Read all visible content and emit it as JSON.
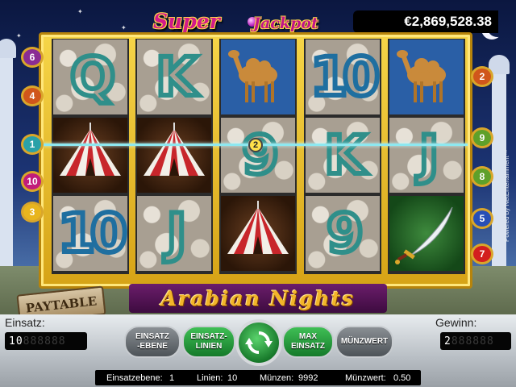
{
  "jackpot": {
    "super_label": "Super",
    "jackpot_label": "Jackpot",
    "amount": "€2,869,528.38"
  },
  "reels": [
    [
      {
        "symbol": "Q",
        "type": "letter-blue"
      },
      {
        "symbol": "tent",
        "type": "tent"
      },
      {
        "symbol": "10",
        "type": "number-blue"
      }
    ],
    [
      {
        "symbol": "K",
        "type": "letter-green"
      },
      {
        "symbol": "tent",
        "type": "tent"
      },
      {
        "symbol": "J",
        "type": "letter-teal"
      }
    ],
    [
      {
        "symbol": "camel",
        "type": "camel"
      },
      {
        "symbol": "9",
        "type": "number-green"
      },
      {
        "symbol": "tent",
        "type": "tent"
      }
    ],
    [
      {
        "symbol": "10",
        "type": "number-blue"
      },
      {
        "symbol": "K",
        "type": "letter-green"
      },
      {
        "symbol": "9",
        "type": "number-green"
      }
    ],
    [
      {
        "symbol": "camel",
        "type": "camel"
      },
      {
        "symbol": "J",
        "type": "letter-teal"
      },
      {
        "symbol": "sword",
        "type": "sword"
      }
    ]
  ],
  "line_markers": {
    "left": [
      "6",
      "4",
      "1",
      "10",
      "3"
    ],
    "right": [
      "2",
      "9",
      "8",
      "5",
      "7"
    ]
  },
  "active_payline_badge": "2",
  "title_banner": "Arabian Nights",
  "paytable_label": "PAYTABLE",
  "panel": {
    "bet_label": "Einsatz:",
    "bet_value": "10",
    "bet_ghost": "888888",
    "win_label": "Gewinn:",
    "win_value": "2",
    "win_ghost": "888888",
    "buttons": {
      "bet_level": "EINSATZ\n-EBENE",
      "bet_lines": "EINSATZ-\nLINIEN",
      "max_bet": "MAX\nEINSATZ",
      "coin_value": "MÜNZWERT"
    }
  },
  "infobar": {
    "bet_level_label": "Einsatzebene:",
    "bet_level_value": "1",
    "lines_label": "Linien:",
    "lines_value": "10",
    "coins_label": "Münzen:",
    "coins_value": "9992",
    "coin_value_label": "Münzwert:",
    "coin_value_value": "0.50"
  },
  "powered_by": "Powered by NetEntertainment™",
  "colors": {
    "frame_gold": "#f6d548",
    "payline": "#8de8f0",
    "symbol_blue": "#1f6fa0",
    "symbol_teal": "#2f8f8a",
    "spin_green": "#17792a"
  }
}
